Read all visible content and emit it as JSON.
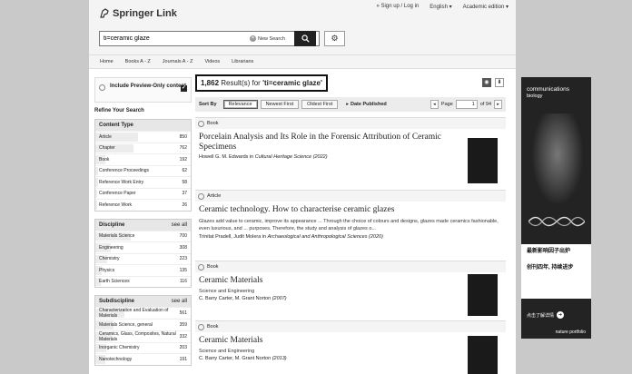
{
  "header": {
    "logo_text": "Springer Link",
    "sign_in": "» Sign up / Log in",
    "language": "English",
    "edition": "Academic edition",
    "search_value": "ti=ceramic glaze",
    "new_search": "New Search"
  },
  "nav": [
    "Home",
    "Books A - Z",
    "Journals A - Z",
    "Videos",
    "Librarians"
  ],
  "sidebar": {
    "preview_label": "Include Preview-Only content",
    "refine": "Refine Your Search",
    "content_type": {
      "title": "Content Type",
      "items": [
        {
          "label": "Article",
          "count": "850",
          "frac": 0.45
        },
        {
          "label": "Chapter",
          "count": "762",
          "frac": 0.4
        },
        {
          "label": "Book",
          "count": "192",
          "frac": 0.1
        },
        {
          "label": "Conference Proceedings",
          "count": "62",
          "frac": 0.03
        },
        {
          "label": "Reference Work Entry",
          "count": "58",
          "frac": 0.03
        },
        {
          "label": "Conference Paper",
          "count": "37",
          "frac": 0.02
        },
        {
          "label": "Reference Work",
          "count": "26",
          "frac": 0.015
        }
      ]
    },
    "discipline": {
      "title": "Discipline",
      "see_all": "see all",
      "items": [
        {
          "label": "Materials Science",
          "count": "700",
          "frac": 0.37
        },
        {
          "label": "Engineering",
          "count": "308",
          "frac": 0.16
        },
        {
          "label": "Chemistry",
          "count": "223",
          "frac": 0.12
        },
        {
          "label": "Physics",
          "count": "135",
          "frac": 0.07
        },
        {
          "label": "Earth Sciences",
          "count": "116",
          "frac": 0.06
        }
      ]
    },
    "subdiscipline": {
      "title": "Subdiscipline",
      "see_all": "see all",
      "items": [
        {
          "label": "Characterization and Evaluation of Materials",
          "count": "561",
          "frac": 0.3
        },
        {
          "label": "Materials Science, general",
          "count": "359",
          "frac": 0.19
        },
        {
          "label": "Ceramics, Glass, Composites, Natural Materials",
          "count": "332",
          "frac": 0.18
        },
        {
          "label": "Inorganic Chemistry",
          "count": "203",
          "frac": 0.11
        },
        {
          "label": "Nanotechnology",
          "count": "191",
          "frac": 0.1
        }
      ]
    }
  },
  "results": {
    "count": "1,862",
    "count_text": "Result(s) for",
    "query": "'ti=ceramic glaze'",
    "sort_by": "Sort By",
    "sort_options": [
      "Relevance",
      "Newest First",
      "Oldest First"
    ],
    "date_published": "Date Published",
    "page_label": "Page",
    "page_value": "1",
    "page_of": "of 94",
    "items": [
      {
        "type": "Book",
        "title": "Porcelain Analysis and Its Role in the Forensic Attribution of Ceramic Specimens",
        "authors": "Howell G. M. Edwards in",
        "source": "Cultural Heritage Science (2022)"
      },
      {
        "type": "Article",
        "title": "Ceramic technology. How to characterise ceramic glazes",
        "snippet": "Glazes add value to ceramic, improve its appearance ... Through the choice of colours and designs, glazes made ceramics fashionable, even luxurious, and ... purposes. Therefore, the study and analysis of glazes o...",
        "authors": "Trinitat Pradell, Judit Molera in",
        "source": "Archaeological and Anthropological Sciences (2020)"
      },
      {
        "type": "Book",
        "title": "Ceramic Materials",
        "subtitle": "Science and Engineering",
        "authors": "C. Barry Carter, M. Grant Norton",
        "source": "(2007)"
      },
      {
        "type": "Book",
        "title": "Ceramic Materials",
        "subtitle": "Science and Engineering",
        "authors": "C. Barry Carter, M. Grant Norton",
        "source": "(2013)"
      }
    ]
  },
  "ad": {
    "brand": "communications",
    "brand2": "biology",
    "cn1": "最新影响因子出炉",
    "cn2": "创刊四年, 持续进步",
    "cta": "点击了解详情",
    "footer": "nature portfolio"
  }
}
